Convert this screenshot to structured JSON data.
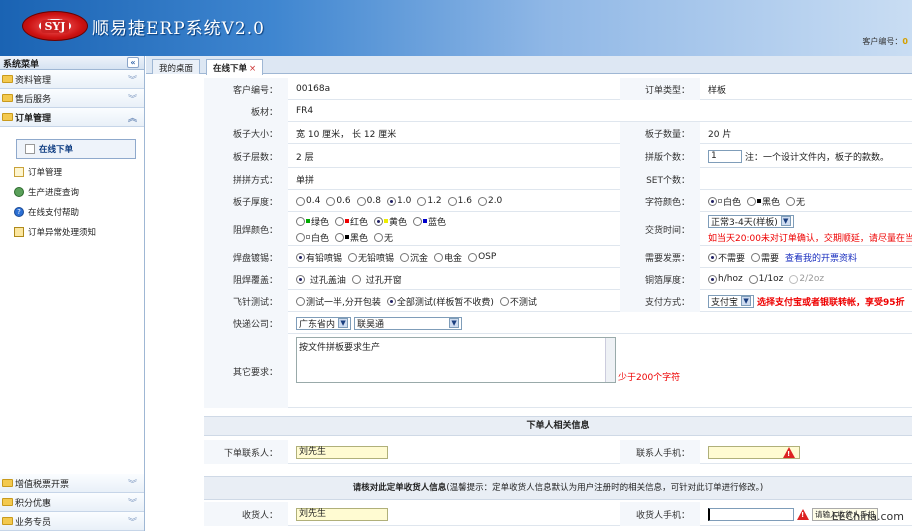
{
  "header": {
    "logo_text": "SYJ",
    "title": "顺易捷ERP系统V2.0",
    "customer_id_label": "客户编号："
  },
  "sidebar": {
    "title": "系统菜单",
    "collapse": "«",
    "sections_top": [
      {
        "label": "资料管理"
      },
      {
        "label": "售后服务"
      },
      {
        "label": "订单管理"
      }
    ],
    "items": [
      {
        "label": "在线下单",
        "icon": "page-icon"
      },
      {
        "label": "订单管理",
        "icon": "note-icon"
      },
      {
        "label": "生产进度查询",
        "icon": "gear-icon"
      },
      {
        "label": "在线支付帮助",
        "icon": "help-icon"
      },
      {
        "label": "订单异常处理须知",
        "icon": "warning-doc-icon"
      }
    ],
    "sections_bottom": [
      {
        "label": "增值税票开票"
      },
      {
        "label": "积分优惠"
      },
      {
        "label": "业务专员"
      }
    ]
  },
  "tabs": [
    {
      "label": "我的桌面"
    },
    {
      "label": "在线下单",
      "close": "×"
    }
  ],
  "form": {
    "customer_no": {
      "label": "客户编号：",
      "value": "00168a"
    },
    "order_type": {
      "label": "订单类型：",
      "value": "样板"
    },
    "board_material": {
      "label": "板材：",
      "value": "FR4"
    },
    "board_size": {
      "label": "板子大小：",
      "value": "宽 10 厘米， 长 12 厘米"
    },
    "board_qty": {
      "label": "板子数量：",
      "value": "20 片"
    },
    "layers": {
      "label": "板子层数：",
      "value": "2 层"
    },
    "panel_count": {
      "label": "拼版个数：",
      "value": "1",
      "note": "注：一个设计文件内，板子的款数。"
    },
    "panel_mode": {
      "label": "拼拼方式：",
      "value": "单拼"
    },
    "set_count": {
      "label": "SET个数：",
      "value": ""
    },
    "thickness": {
      "label": "板子厚度：",
      "options": [
        "0.4",
        "0.6",
        "0.8",
        "1.0",
        "1.2",
        "1.6",
        "2.0"
      ],
      "selected": "1.0"
    },
    "silk_color": {
      "label": "字符颜色：",
      "options": [
        "白色",
        "黑色",
        "无"
      ],
      "selected": "白色"
    },
    "mask_color": {
      "label": "阻焊颜色：",
      "options_row1": [
        "绿色",
        "红色",
        "黄色",
        "蓝色"
      ],
      "options_row2": [
        "白色",
        "黑色",
        "无"
      ],
      "selected": "黄色"
    },
    "delivery": {
      "label": "交货时间：",
      "value": "正常3-4天(样板)",
      "note": "如当天20:00未对订单确认，交期顺延，请尽量在当"
    },
    "surface": {
      "label": "焊盘镀锡：",
      "options": [
        "有铅喷锡",
        "无铅喷锡",
        "沉金",
        "电金",
        "OSP"
      ],
      "selected": "有铅喷锡"
    },
    "invoice": {
      "label": "需要发票：",
      "options": [
        "不需要",
        "需要"
      ],
      "selected": "不需要",
      "link": "查看我的开票资料"
    },
    "via_cover": {
      "label": "阻焊覆盖：",
      "options": [
        "过孔盖油",
        "过孔开窗"
      ],
      "selected": "过孔盖油"
    },
    "copper": {
      "label": "铜箔厚度：",
      "options": [
        "h/hoz",
        "1/1oz",
        "2/2oz"
      ],
      "selected": "h/hoz"
    },
    "flying_probe": {
      "label": "飞针测试：",
      "options": [
        "测试一半,分开包装",
        "全部测试(样板暂不收费)",
        "不测试"
      ],
      "selected": "全部测试(样板暂不收费)"
    },
    "payment": {
      "label": "支付方式：",
      "value": "支付宝",
      "note": "选择支付宝或者银联转帐，享受95折"
    },
    "courier": {
      "label": "快递公司：",
      "province": "广东省内",
      "company": "联昊通"
    },
    "other": {
      "label": "其它要求：",
      "value": "按文件拼板要求生产",
      "hint": "少于200个字符"
    },
    "orderer_section": {
      "title": "下单人相关信息"
    },
    "orderer_contact": {
      "label": "下单联系人：",
      "value": "刘先生"
    },
    "orderer_phone": {
      "label": "联系人手机：",
      "value": ""
    },
    "receiver_section": {
      "title": "请核对此定单收货人信息",
      "tip": "(温馨提示：定单收货人信息默认为用户注册时的相关信息，可针对此订单进行修改。)"
    },
    "receiver": {
      "label": "收货人：",
      "value": "刘先生"
    },
    "receiver_phone": {
      "label": "收货人手机：",
      "value": "",
      "hint": "请输入收货人手机"
    }
  },
  "watermark": "EEChina.com",
  "colors": {
    "header_start": "#1a63b3",
    "header_end": "#c9ddf3",
    "accent_red": "#ee0000",
    "link_blue": "#1a2fbf"
  }
}
